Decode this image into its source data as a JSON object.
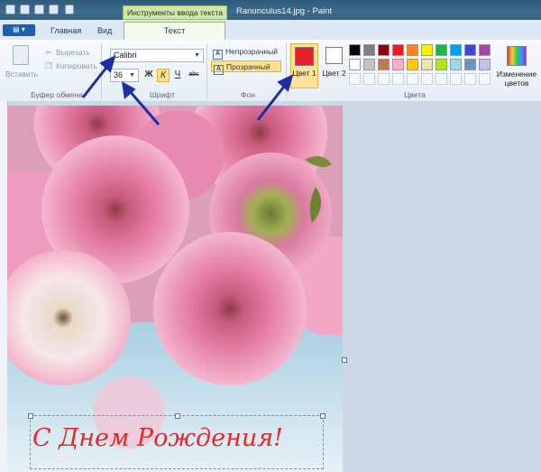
{
  "window": {
    "title": "Ranunculus14.jpg - Paint",
    "context_tab_group": "Инструменты ввода текста"
  },
  "tabs": [
    {
      "label": "Главная"
    },
    {
      "label": "Вид"
    },
    {
      "label": "Текст",
      "active": true
    }
  ],
  "clipboard": {
    "paste_label": "Вставить",
    "cut_label": "Вырезать",
    "copy_label": "Копировать",
    "group_label": "Буфер обмена"
  },
  "font": {
    "name_value": "Calibri",
    "size_value": "36",
    "bold_label": "Ж",
    "italic_label": "К",
    "underline_label": "Ч",
    "strike_label": "abc",
    "group_label": "Шрифт"
  },
  "background": {
    "opaque_label": "Непрозрачный",
    "transparent_label": "Прозрачный",
    "selected": "Прозрачный",
    "group_label": "Фон"
  },
  "colors": {
    "color1_label": "Цвет 1",
    "color2_label": "Цвет 2",
    "color1_value": "#e8202a",
    "color2_value": "#ffffff",
    "edit_label": "Изменение цветов",
    "group_label": "Цвета",
    "palette": [
      "#000000",
      "#7f7f7f",
      "#880015",
      "#ed1c24",
      "#ff7f27",
      "#fff200",
      "#22b14c",
      "#00a2e8",
      "#3f48cc",
      "#a349a4",
      "#ffffff",
      "#c3c3c3",
      "#b97a57",
      "#ffaec9",
      "#ffc90e",
      "#efe4b0",
      "#b5e61d",
      "#99d9ea",
      "#7092be",
      "#c8bfe7",
      "",
      "",
      "",
      "",
      "",
      "",
      "",
      "",
      "",
      ""
    ]
  },
  "canvas": {
    "text": "С Днем Рождения!",
    "text_color": "#e8272b"
  }
}
